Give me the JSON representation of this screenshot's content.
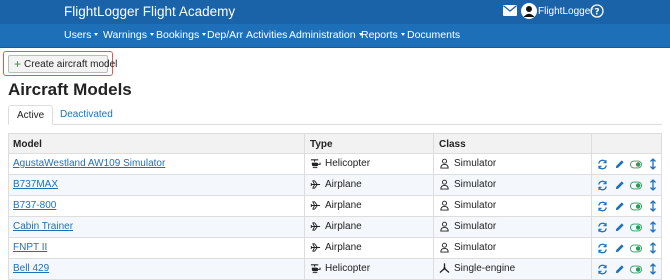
{
  "header": {
    "app_title": "FlightLogger Flight Academy",
    "user_name": "FlightLogger"
  },
  "nav": {
    "items": [
      {
        "label": "Users",
        "dropdown": true
      },
      {
        "label": "Warnings",
        "dropdown": true
      },
      {
        "label": "Bookings",
        "dropdown": true
      },
      {
        "label": "Dep/Arr",
        "dropdown": false
      },
      {
        "label": "Activities",
        "dropdown": false
      },
      {
        "label": "Administration",
        "dropdown": true
      },
      {
        "label": "Reports",
        "dropdown": true
      },
      {
        "label": "Documents",
        "dropdown": false
      }
    ]
  },
  "toolbar": {
    "create_label": "Create aircraft model"
  },
  "page": {
    "title": "Aircraft Models"
  },
  "tabs": [
    {
      "label": "Active",
      "active": true
    },
    {
      "label": "Deactivated",
      "active": false
    }
  ],
  "table": {
    "columns": [
      "Model",
      "Type",
      "Class"
    ],
    "rows": [
      {
        "model": "AgustaWestland AW109 Simulator",
        "type": "Helicopter",
        "class": "Simulator"
      },
      {
        "model": "B737MAX",
        "type": "Airplane",
        "class": "Simulator"
      },
      {
        "model": "B737-800",
        "type": "Airplane",
        "class": "Simulator"
      },
      {
        "model": "Cabin Trainer",
        "type": "Airplane",
        "class": "Simulator"
      },
      {
        "model": "FNPT II",
        "type": "Airplane",
        "class": "Simulator"
      },
      {
        "model": "Bell 429",
        "type": "Helicopter",
        "class": "Single-engine"
      }
    ]
  },
  "colors": {
    "topbar": "#1a63a8",
    "navbar": "#1d70b8",
    "link": "#1d70b8",
    "action_blue": "#1d70b8",
    "toggle_green": "#2e9a5c",
    "highlight": "#e2584c"
  }
}
